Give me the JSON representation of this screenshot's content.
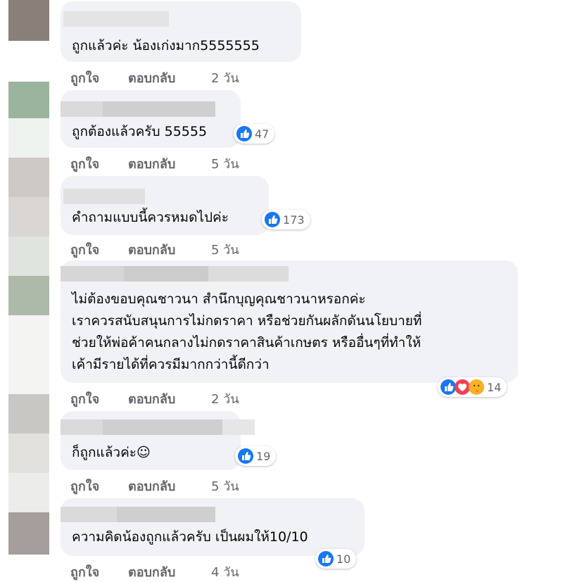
{
  "colors": {
    "bubble": "#f0f2f5",
    "like": "#1877f2",
    "love": "#f33e58",
    "care": "#f7b125",
    "meta_text": "#65676b"
  },
  "actions": {
    "like": "ถูกใจ",
    "reply": "ตอบกลับ"
  },
  "comments": [
    {
      "text_lines": [
        "ถูกแล้วค่ะ น้องเก่งมาก5555555"
      ],
      "time": "2 วัน",
      "reaction_count": ""
    },
    {
      "text_lines": [
        "ถูกต้องแล้วครับ 55555"
      ],
      "time": "5 วัน",
      "reaction_count": "47",
      "reactions": [
        "like-icon"
      ]
    },
    {
      "text_lines": [
        "คำถามแบบนี้ควรหมดไปค่ะ"
      ],
      "time": "5 วัน",
      "reaction_count": "173",
      "reactions": [
        "like-icon"
      ]
    },
    {
      "text_lines": [
        "ไม่ต้องขอบคุณชาวนา สำนึกบุญคุณชาวนาหรอกค่ะ",
        "เราควรสนับสนุนการไม่กดราคา หรือช่วยกันผลักดันนโยบายที่",
        "ช่วยให้พ่อค้าคนกลางไม่กดราคาสินค้าเกษตร หรืออื่นๆที่ทำให้",
        "เค้ามีรายได้ที่ควรมีมากกว่านี้ดีกว่า"
      ],
      "time": "2 วัน",
      "reaction_count": "14",
      "reactions": [
        "like-icon",
        "love-icon",
        "care-icon"
      ]
    },
    {
      "text_lines": [
        "ก็ถูกแล้วค่ะ☺"
      ],
      "time": "5 วัน",
      "reaction_count": "19",
      "reactions": [
        "like-icon"
      ]
    },
    {
      "text_lines": [
        "ความคิดน้องถูกแล้วครับ เป็นผมให้10/10"
      ],
      "time": "4 วัน",
      "reaction_count": "10",
      "reactions": [
        "like-icon"
      ]
    }
  ]
}
